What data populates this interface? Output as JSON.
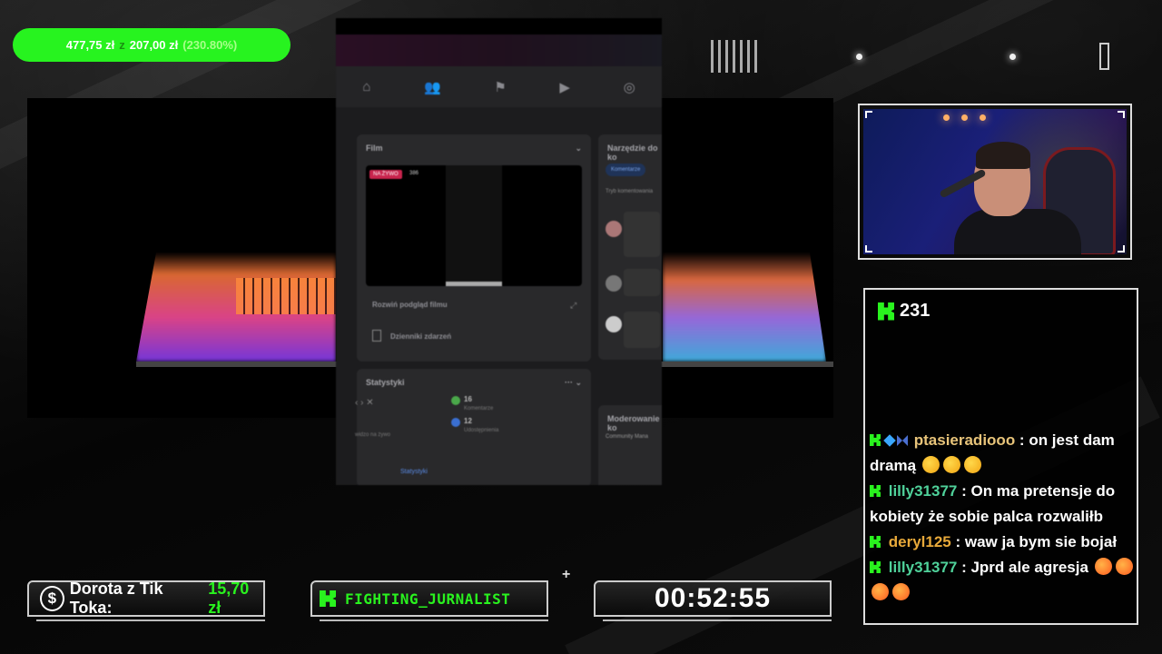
{
  "goal": {
    "current": "477,75 zł",
    "separator": "z",
    "target": "207,00 zł",
    "percent": "(230.80%)"
  },
  "screen": {
    "nav_icons": [
      "home-icon",
      "friends-icon",
      "flag-icon",
      "video-icon",
      "globe-icon"
    ],
    "film_panel": {
      "title": "Film",
      "live_label": "NA ŻYWO",
      "views": "386",
      "expand_label": "Rozwiń podgląd filmu",
      "events_label": "Dzienniki zdarzeń"
    },
    "tools_panel": {
      "title": "Narzędzie do ko",
      "chip": "Komentarze",
      "sub": "Tryb komentowania"
    },
    "stats_panel": {
      "title": "Statystyki",
      "stat1_value": "16",
      "stat1_label": "Komentarze",
      "stat2_value": "12",
      "stat2_label": "Udostępnienia",
      "link": "Statystyki",
      "left_text": "widzo na żywo"
    },
    "mod_panel": {
      "title": "Moderowanie ko",
      "sub": "Community Mana"
    }
  },
  "chat": {
    "viewer_count": "231",
    "messages": [
      {
        "user": "ptasieradiooo",
        "user_color": "#e8c47a",
        "text": "on jest dam dramą",
        "emotes": 3,
        "badges": true
      },
      {
        "user": "lilly31377",
        "user_color": "#4fd19a",
        "text": "On ma pretensje do kobiety że sobie palca rozwaliłb",
        "emotes": 0,
        "badges": false
      },
      {
        "user": "deryl125",
        "user_color": "#e8a93a",
        "text": "waw ja bym sie bojał",
        "emotes": 0,
        "badges": false
      },
      {
        "user": "lilly31377",
        "user_color": "#4fd19a",
        "text": "Jprd ale agresja",
        "emotes": 4,
        "badges": false
      }
    ]
  },
  "bottom": {
    "donor_name": "Dorota z Tik Toka:",
    "donor_amount": "15,70 zł",
    "latest_follower": "FIGHTING_JURNALIST",
    "timer": "00:52:55"
  },
  "colors": {
    "kick_green": "#29f31e",
    "goal_green": "#27f31f"
  }
}
